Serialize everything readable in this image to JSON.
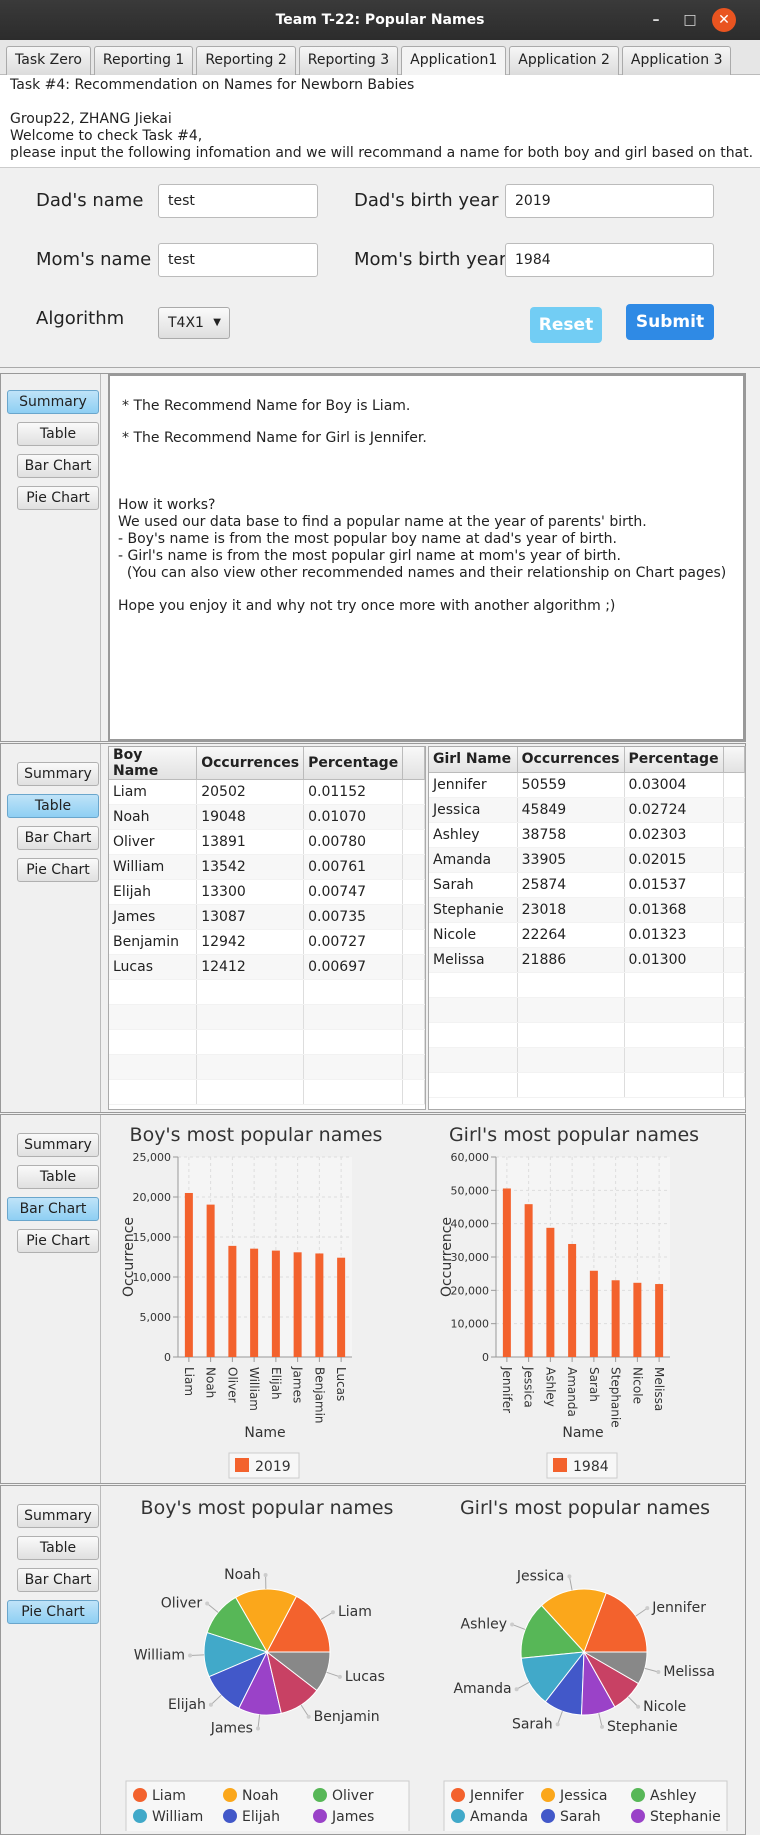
{
  "window": {
    "title": "Team T-22: Popular Names",
    "min_glyph": "–",
    "max_glyph": "□",
    "close_glyph": "✕"
  },
  "tabs": [
    "Task Zero",
    "Reporting 1",
    "Reporting 2",
    "Reporting 3",
    "Application1",
    "Application 2",
    "Application 3"
  ],
  "info": {
    "line1": "Task #4: Recommendation on Names for Newborn Babies",
    "line2": "Group22, ZHANG Jiekai",
    "line3": "Welcome to check Task #4,",
    "line4": "please input the following infomation and we will recommand a name for both boy and girl based on that."
  },
  "form": {
    "dad_name_label": "Dad's name",
    "dad_name_value": "test",
    "dad_year_label": "Dad's birth year",
    "dad_year_value": "2019",
    "mom_name_label": "Mom's name",
    "mom_name_value": "test",
    "mom_year_label": "Mom's birth year",
    "mom_year_value": "1984",
    "algorithm_label": "Algorithm",
    "algorithm_value": "T4X1",
    "reset_label": "Reset",
    "submit_label": "Submit"
  },
  "nav": {
    "summary": "Summary",
    "table": "Table",
    "bar": "Bar Chart",
    "pie": "Pie Chart"
  },
  "summary": {
    "boy": "* The Recommend Name for Boy is Liam.",
    "girl": "* The Recommend Name for Girl is Jennifer.",
    "how": "How it works?",
    "l1": "We used our data base to find a popular name at the year of parents' birth.",
    "l2": "- Boy's name is from the most popular boy name at dad's year of birth.",
    "l3": "- Girl's name is from the most popular girl name at mom's year of birth.",
    "l4": "  (You can also view other recommended names and their relationship on Chart pages)",
    "l5": "Hope you enjoy it and why not try once more with another algorithm ;)"
  },
  "boy_table": {
    "headers": [
      "Boy Name",
      "Occurrences",
      "Percentage"
    ],
    "rows": [
      [
        "Liam",
        "20502",
        "0.01152"
      ],
      [
        "Noah",
        "19048",
        "0.01070"
      ],
      [
        "Oliver",
        "13891",
        "0.00780"
      ],
      [
        "William",
        "13542",
        "0.00761"
      ],
      [
        "Elijah",
        "13300",
        "0.00747"
      ],
      [
        "James",
        "13087",
        "0.00735"
      ],
      [
        "Benjamin",
        "12942",
        "0.00727"
      ],
      [
        "Lucas",
        "12412",
        "0.00697"
      ]
    ]
  },
  "girl_table": {
    "headers": [
      "Girl Name",
      "Occurrences",
      "Percentage"
    ],
    "rows": [
      [
        "Jennifer",
        "50559",
        "0.03004"
      ],
      [
        "Jessica",
        "45849",
        "0.02724"
      ],
      [
        "Ashley",
        "38758",
        "0.02303"
      ],
      [
        "Amanda",
        "33905",
        "0.02015"
      ],
      [
        "Sarah",
        "25874",
        "0.01537"
      ],
      [
        "Stephanie",
        "23018",
        "0.01368"
      ],
      [
        "Nicole",
        "22264",
        "0.01323"
      ],
      [
        "Melissa",
        "21886",
        "0.01300"
      ]
    ]
  },
  "colors": {
    "bar": "#f3622d",
    "accent_blue": "#2f8ae5",
    "reset_blue": "#72cdf4"
  },
  "chart_data": [
    {
      "type": "bar",
      "title": "Boy's most popular names",
      "xlabel": "Name",
      "ylabel": "Occurrence",
      "categories": [
        "Liam",
        "Noah",
        "Oliver",
        "William",
        "Elijah",
        "James",
        "Benjamin",
        "Lucas"
      ],
      "series": [
        {
          "name": "2019",
          "values": [
            20502,
            19048,
            13891,
            13542,
            13300,
            13087,
            12942,
            12412
          ]
        }
      ],
      "ylim": [
        0,
        25000
      ],
      "yticks": [
        "0",
        "5,000",
        "10,000",
        "15,000",
        "20,000",
        "25,000"
      ],
      "grid": true,
      "legend": "bottom"
    },
    {
      "type": "bar",
      "title": "Girl's most popular names",
      "xlabel": "Name",
      "ylabel": "Occurrence",
      "categories": [
        "Jennifer",
        "Jessica",
        "Ashley",
        "Amanda",
        "Sarah",
        "Stephanie",
        "Nicole",
        "Melissa"
      ],
      "series": [
        {
          "name": "1984",
          "values": [
            50559,
            45849,
            38758,
            33905,
            25874,
            23018,
            22264,
            21886
          ]
        }
      ],
      "ylim": [
        0,
        60000
      ],
      "yticks": [
        "0",
        "10,000",
        "20,000",
        "30,000",
        "40,000",
        "50,000",
        "60,000"
      ],
      "grid": true,
      "legend": "bottom"
    },
    {
      "type": "pie",
      "title": "Boy's most popular names",
      "categories": [
        "Liam",
        "Noah",
        "Oliver",
        "William",
        "Elijah",
        "James",
        "Benjamin",
        "Lucas"
      ],
      "values": [
        20502,
        19048,
        13891,
        13542,
        13300,
        13087,
        12942,
        12412
      ],
      "colors": [
        "#f3622d",
        "#fba71b",
        "#57b757",
        "#41a9c9",
        "#4258c9",
        "#9a42c8",
        "#c84164",
        "#888888"
      ],
      "legend": "bottom"
    },
    {
      "type": "pie",
      "title": "Girl's most popular names",
      "categories": [
        "Jennifer",
        "Jessica",
        "Ashley",
        "Amanda",
        "Sarah",
        "Stephanie",
        "Nicole",
        "Melissa"
      ],
      "values": [
        50559,
        45849,
        38758,
        33905,
        25874,
        23018,
        22264,
        21886
      ],
      "colors": [
        "#f3622d",
        "#fba71b",
        "#57b757",
        "#41a9c9",
        "#4258c9",
        "#9a42c8",
        "#c84164",
        "#888888"
      ],
      "legend": "bottom"
    }
  ]
}
